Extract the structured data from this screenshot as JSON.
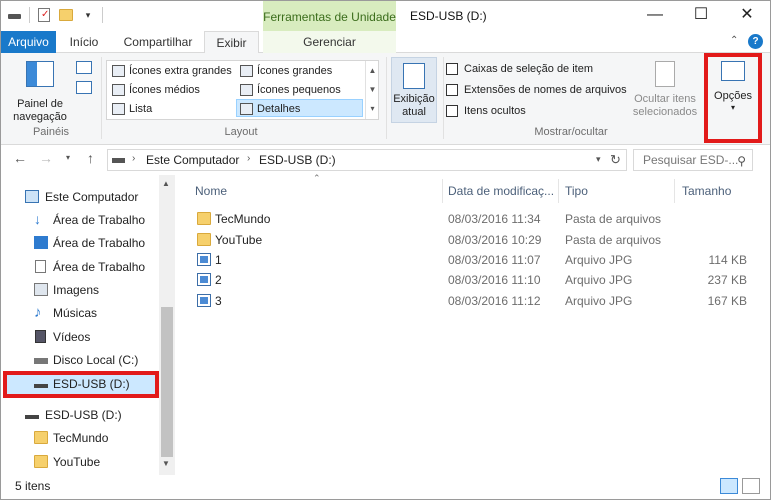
{
  "titlebar": {
    "tools_tab": "Ferramentas de Unidade",
    "title": "ESD-USB (D:)",
    "minimize": "—",
    "maximize": "☐",
    "close": "✕"
  },
  "tabs": {
    "file": "Arquivo",
    "home": "Início",
    "share": "Compartilhar",
    "view": "Exibir",
    "manage": "Gerenciar"
  },
  "ribbon": {
    "nav_pane": "Painel de navegação",
    "panes_label": "Painéis",
    "layout_items": [
      "Ícones extra grandes",
      "Ícones grandes",
      "Ícones médios",
      "Ícones pequenos",
      "Lista",
      "Detalhes"
    ],
    "layout_label": "Layout",
    "current_view": "Exibição atual",
    "checkbox_items": [
      "Caixas de seleção de item",
      "Extensões de nomes de arquivos",
      "Itens ocultos"
    ],
    "hide_selected": "Ocultar itens selecionados",
    "showhide_label": "Mostrar/ocultar",
    "options": "Opções"
  },
  "address": {
    "computer": "Este Computador",
    "drive": "ESD-USB (D:)",
    "search_placeholder": "Pesquisar ESD-..."
  },
  "nav_items": [
    "Este Computador",
    "Área de Trabalho",
    "Área de Trabalho",
    "Área de Trabalho",
    "Imagens",
    "Músicas",
    "Vídeos",
    "Disco Local (C:)",
    "ESD-USB (D:)",
    "ESD-USB (D:)",
    "TecMundo",
    "YouTube"
  ],
  "columns": {
    "name": "Nome",
    "date": "Data de modificaç...",
    "type": "Tipo",
    "size": "Tamanho"
  },
  "files": [
    {
      "name": "TecMundo",
      "date": "08/03/2016 11:34",
      "type": "Pasta de arquivos",
      "size": ""
    },
    {
      "name": "YouTube",
      "date": "08/03/2016 10:29",
      "type": "Pasta de arquivos",
      "size": ""
    },
    {
      "name": "1",
      "date": "08/03/2016 11:07",
      "type": "Arquivo JPG",
      "size": "114 KB"
    },
    {
      "name": "2",
      "date": "08/03/2016 11:10",
      "type": "Arquivo JPG",
      "size": "237 KB"
    },
    {
      "name": "3",
      "date": "08/03/2016 11:12",
      "type": "Arquivo JPG",
      "size": "167 KB"
    }
  ],
  "status": {
    "count": "5 itens"
  },
  "colors": {
    "accent": "#1979ca",
    "highlight": "#e21a1a",
    "tools_tab_bg": "#d8ecbf"
  }
}
